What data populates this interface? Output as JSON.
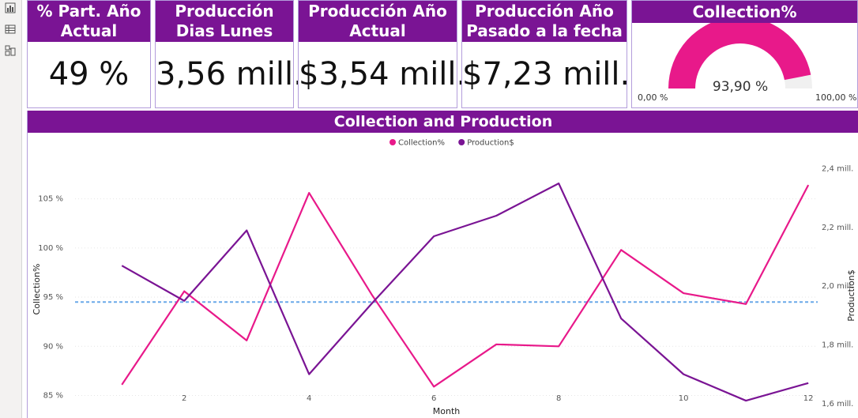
{
  "cards": {
    "part_anio": {
      "title": "% Part. Año Actual",
      "value": "49 %"
    },
    "dias_lunes": {
      "title": "Producción Dias Lunes",
      "value": "3,56 mill."
    },
    "anio_actual": {
      "title": "Producción Año Actual",
      "value": "$3,54 mill."
    },
    "anio_pasado": {
      "title": "Producción Año Pasado a la fecha",
      "value": "$7,23 mill."
    }
  },
  "gauge": {
    "title": "Collection%",
    "value_label": "93,90 %",
    "value": 93.9,
    "min_label": "0,00 %",
    "max_label": "100,00 %",
    "fill_color": "#e8198a",
    "track_color": "#f0f0f0"
  },
  "chart_data": {
    "type": "line",
    "title": "Collection and Production",
    "xlabel": "Month",
    "ylabel_left": "Collection%",
    "ylabel_right": "Production$",
    "legend_position": "top-center",
    "x": [
      1,
      2,
      3,
      4,
      5,
      6,
      7,
      8,
      9,
      10,
      11,
      12
    ],
    "x_ticks": [
      2,
      4,
      6,
      8,
      10,
      12
    ],
    "left_ticks": [
      {
        "value": 85,
        "label": "85 %"
      },
      {
        "value": 90,
        "label": "90 %"
      },
      {
        "value": 95,
        "label": "95 %"
      },
      {
        "value": 100,
        "label": "100 %"
      },
      {
        "value": 105,
        "label": "105 %"
      }
    ],
    "right_ticks": [
      {
        "value": 1.6,
        "label": "1,6 mill."
      },
      {
        "value": 1.8,
        "label": "1,8 mill."
      },
      {
        "value": 2.0,
        "label": "2,0 mill."
      },
      {
        "value": 2.2,
        "label": "2,2 mill."
      },
      {
        "value": 2.4,
        "label": "2,4 mill."
      }
    ],
    "left_ylim": [
      84,
      108.5
    ],
    "right_ylim": [
      1.594,
      2.415
    ],
    "grid": true,
    "reference_line": {
      "axis": "left",
      "value": 94.5,
      "color": "#6aa9e9"
    },
    "series": [
      {
        "name": "Collection%",
        "axis": "left",
        "color": "#e8198a",
        "values": [
          86.1,
          95.6,
          90.6,
          105.6,
          95.3,
          85.9,
          90.2,
          90.0,
          99.8,
          95.4,
          94.3,
          106.4
        ]
      },
      {
        "name": "Production$",
        "axis": "right",
        "color": "#7a1494",
        "values": [
          2.07,
          1.95,
          2.19,
          1.7,
          1.94,
          2.17,
          2.24,
          2.35,
          1.89,
          1.7,
          1.61,
          1.67
        ]
      }
    ]
  }
}
